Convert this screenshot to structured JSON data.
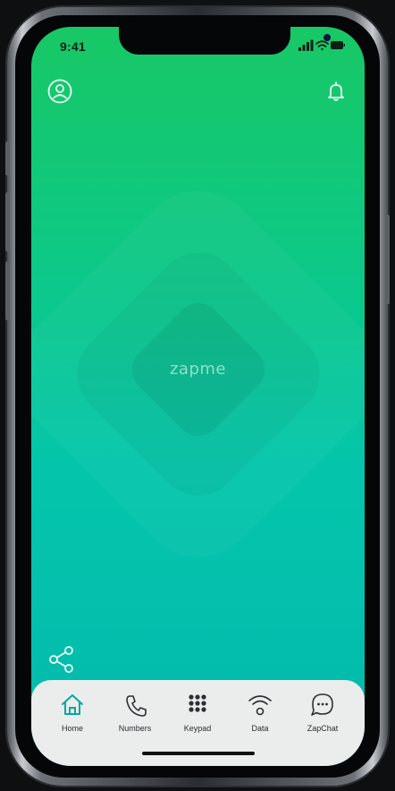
{
  "status_bar": {
    "time": "9:41"
  },
  "header": {
    "profile_icon": "user-circle-icon",
    "notification_icon": "bell-icon"
  },
  "brand": {
    "logo_text": "zapme",
    "gradient_top": "#18c865",
    "gradient_bottom": "#03b9ad"
  },
  "actions": {
    "share_icon": "share-icon"
  },
  "tabbar": {
    "active_color": "#0aa79b",
    "tabs": [
      {
        "label": "Home",
        "icon": "home-icon",
        "active": true
      },
      {
        "label": "Numbers",
        "icon": "phone-icon",
        "active": false
      },
      {
        "label": "Keypad",
        "icon": "keypad-icon",
        "active": false
      },
      {
        "label": "Data",
        "icon": "wifi-icon",
        "active": false
      },
      {
        "label": "ZapChat",
        "icon": "chat-bubble-icon",
        "active": false
      }
    ]
  }
}
